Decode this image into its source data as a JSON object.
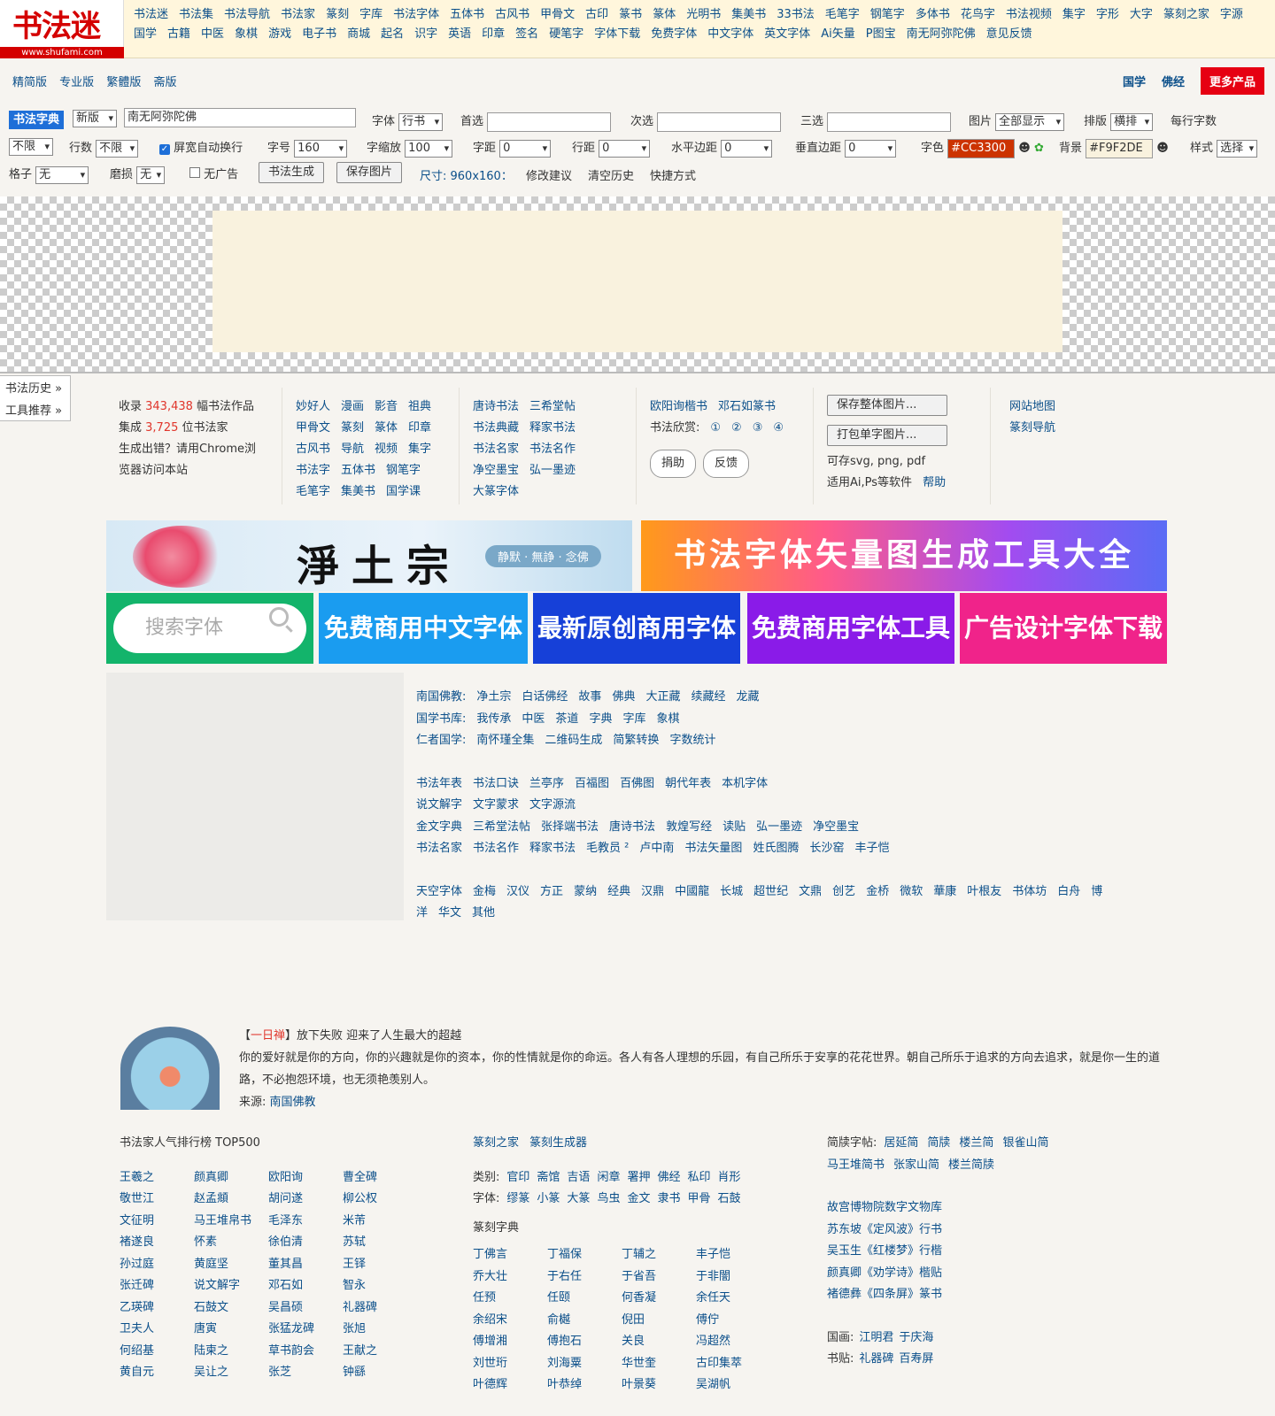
{
  "logo": {
    "text": "书法迷",
    "url": "www.shufami.com"
  },
  "topnav": [
    "书法迷",
    "书法集",
    "书法导航",
    "书法家",
    "篆刻",
    "字库",
    "书法字体",
    "五体书",
    "古风书",
    "甲骨文",
    "古印",
    "篆书",
    "篆体",
    "光明书",
    "集美书",
    "33书法",
    "毛笔字",
    "钢笔字",
    "多体书",
    "花鸟字",
    "书法视频",
    "集字",
    "字形",
    "大字",
    "篆刻之家",
    "字源",
    "国学",
    "古籍",
    "中医",
    "象棋",
    "游戏",
    "电子书",
    "商城",
    "起名",
    "识字",
    "英语",
    "印章",
    "签名",
    "硬笔字",
    "字体下载",
    "免费字体",
    "中文字体",
    "英文字体",
    "Ai矢量",
    "P图宝",
    "南无阿弥陀佛",
    "意见反馈"
  ],
  "versions": [
    "精简版",
    "专业版",
    "繁體版",
    "斋版"
  ],
  "right_buttons": {
    "guoxue": "国学",
    "fojing": "佛经",
    "more": "更多产品"
  },
  "controls": {
    "tag": "书法字典",
    "version_select": "新版",
    "text_value": "南无阿弥陀佛",
    "font_label": "字体",
    "font_value": "行书",
    "first_label": "首选",
    "second_label": "次选",
    "third_label": "三选",
    "image_label": "图片",
    "image_value": "全部显示",
    "layout_label": "排版",
    "layout_value": "横排",
    "perline_label": "每行字数",
    "perline_value": "不限",
    "rows_label": "行数",
    "rows_value": "不限",
    "autowrap": "屏宽自动换行",
    "size_label": "字号",
    "size_value": "160",
    "scale_label": "字缩放",
    "scale_value": "100",
    "spacing_label": "字距",
    "spacing_value": "0",
    "linespace_label": "行距",
    "linespace_value": "0",
    "hmargin_label": "水平边距",
    "hmargin_value": "0",
    "vmargin_label": "垂直边距",
    "vmargin_value": "0",
    "color_label": "字色",
    "color_value": "#CC3300",
    "bg_label": "背景",
    "bg_value": "#F9F2DE",
    "style_label": "样式",
    "style_value": "选择",
    "grid_label": "格子",
    "grid_value": "无",
    "wear_label": "磨损",
    "wear_value": "无",
    "noad": "无广告",
    "generate": "书法生成",
    "save": "保存图片",
    "size_info": "尺寸: 960x160：",
    "suggest": "修改建议",
    "clear": "清空历史",
    "shortcut": "快捷方式"
  },
  "colors": {
    "text_color": "#CC3300",
    "bg_color": "#F9F2DE",
    "accent": "#1e6fd8",
    "brand": "#d40000"
  },
  "sidetabs": [
    "书法历史 »",
    "工具推荐 »"
  ],
  "info": {
    "l1a": "收录 ",
    "l1n": "343,438",
    "l1b": " 幅书法作品",
    "l2a": "集成 ",
    "l2n": "3,725",
    "l2b": " 位书法家",
    "l3": "生成出错？请用Chrome浏",
    "l4": "览器访问本站"
  },
  "col2": [
    [
      "妙好人",
      "漫画",
      "影音",
      "祖典"
    ],
    [
      "甲骨文",
      "篆刻",
      "篆体",
      "印章"
    ],
    [
      "古风书",
      "导航",
      "视频",
      "集字"
    ],
    [
      "书法字",
      "五体书",
      "钢笔字"
    ],
    [
      "毛笔字",
      "集美书",
      "国学课"
    ]
  ],
  "col3": [
    [
      "唐诗书法",
      "三希堂帖"
    ],
    [
      "书法典藏",
      "释家书法"
    ],
    [
      "书法名家",
      "书法名作"
    ],
    [
      "净空墨宝",
      "弘一墨迹"
    ],
    [
      "大篆字体"
    ]
  ],
  "col4": {
    "r1": [
      "欧阳询楷书",
      "邓石如篆书"
    ],
    "appreciate": "书法欣赏:",
    "nums": [
      "①",
      "②",
      "③",
      "④"
    ],
    "donate": "捐助",
    "feedback": "反馈"
  },
  "col5": {
    "save_all": "保存整体图片...",
    "pack": "打包单字图片...",
    "note1": "可存svg, png, pdf",
    "note2": "适用Ai,Ps等软件",
    "help": "帮助"
  },
  "col6": [
    "网站地图",
    "篆刻导航"
  ],
  "banner1": {
    "title": "淨土宗",
    "pill": "静默 · 無諍 · 念佛"
  },
  "banner2": "书法字体矢量图生成工具大全",
  "search_placeholder": "搜索字体",
  "tiles": [
    "免费商用中文字体",
    "最新原创商用字体",
    "免费商用字体工具",
    "广告设计字体下载"
  ],
  "links2": {
    "r1": {
      "label": "南国佛教:",
      "items": [
        "净土宗",
        "白话佛经",
        "故事",
        "佛典",
        "大正藏",
        "续藏经",
        "龙藏"
      ]
    },
    "r2": {
      "label": "国学书库:",
      "items": [
        "我传承",
        "中医",
        "茶道",
        "字典",
        "字库",
        "象棋"
      ]
    },
    "r3": {
      "label": "仁者国学:",
      "items": [
        "南怀瑾全集",
        "二维码生成",
        "简繁转换",
        "字数统计"
      ]
    },
    "r4": [
      "书法年表",
      "书法口诀",
      "兰亭序",
      "百福图",
      "百佛图",
      "朝代年表",
      "本机字体"
    ],
    "r5": [
      "说文解字",
      "文字蒙求",
      "文字源流"
    ],
    "r6": [
      "金文字典",
      "三希堂法帖",
      "张择端书法",
      "唐诗书法",
      "敦煌写经",
      "读贴",
      "弘一墨迹",
      "净空墨宝"
    ],
    "r7": [
      "书法名家",
      "书法名作",
      "释家书法",
      "毛教员 ²",
      "卢中南",
      "书法矢量图",
      "姓氏图腾",
      "长沙窑",
      "丰子恺"
    ],
    "r8": [
      "天空字体",
      "金梅",
      "汉仪",
      "方正",
      "蒙纳",
      "经典",
      "汉鼎",
      "中國龍",
      "长城",
      "超世纪",
      "文鼎",
      "创艺",
      "金桥",
      "微软",
      "華康",
      "叶根友",
      "书体坊",
      "白舟",
      "博"
    ],
    "r9": [
      "洋",
      "华文",
      "其他"
    ]
  },
  "quote": {
    "bracket_l": "【",
    "tag": "一日禅",
    "bracket_r": "】",
    "title": "放下失败 迎来了人生最大的超越",
    "body": "你的爱好就是你的方向，你的兴趣就是你的资本，你的性情就是你的命运。各人有各人理想的乐园，有自己所乐于安享的花花世界。朝自己所乐于追求的方向去追求，就是你一生的道路，不必抱怨环境，也无须艳羡别人。",
    "source_label": "来源:",
    "source": "南国佛教"
  },
  "bottom_left": {
    "title": "书法家人气排行榜 TOP500",
    "names": [
      [
        "王羲之",
        "颜真卿",
        "欧阳询",
        "曹全碑"
      ],
      [
        "敬世江",
        "赵孟頫",
        "胡问遂",
        "柳公权"
      ],
      [
        "文征明",
        "马王堆帛书",
        "毛泽东",
        "米芾"
      ],
      [
        "褚遂良",
        "怀素",
        "徐伯清",
        "苏轼"
      ],
      [
        "孙过庭",
        "黄庭坚",
        "董其昌",
        "王铎"
      ],
      [
        "张迁碑",
        "说文解字",
        "邓石如",
        "智永"
      ],
      [
        "乙瑛碑",
        "石鼓文",
        "吴昌硕",
        "礼器碑"
      ],
      [
        "卫夫人",
        "唐寅",
        "张猛龙碑",
        "张旭"
      ],
      [
        "何绍基",
        "陆柬之",
        "草书韵会",
        "王献之"
      ],
      [
        "黄自元",
        "吴让之",
        "张芝",
        "钟繇"
      ]
    ]
  },
  "bottom_mid": {
    "t1": "篆刻之家",
    "t2": "篆刻生成器",
    "cat_label": "类别:",
    "cats": [
      "官印",
      "斋馆",
      "吉语",
      "闲章",
      "署押",
      "佛经",
      "私印",
      "肖形"
    ],
    "font_label": "字体:",
    "fonts": [
      "缪篆",
      "小篆",
      "大篆",
      "鸟虫",
      "金文",
      "隶书",
      "甲骨",
      "石鼓"
    ],
    "dict": "篆刻字典",
    "names": [
      [
        "丁佛言",
        "丁福保",
        "丁辅之",
        "丰子恺"
      ],
      [
        "乔大壮",
        "于右任",
        "于省吾",
        "于非闇"
      ],
      [
        "任预",
        "任颐",
        "何香凝",
        "余任天"
      ],
      [
        "余绍宋",
        "俞樾",
        "倪田",
        "傅佇"
      ],
      [
        "傅增湘",
        "傅抱石",
        "关良",
        "冯超然"
      ],
      [
        "刘世珩",
        "刘海粟",
        "华世奎",
        "古印集萃"
      ],
      [
        "叶德辉",
        "叶恭绰",
        "叶景葵",
        "吴湖帆"
      ]
    ]
  },
  "bottom_right": {
    "label": "简牍字帖:",
    "items": [
      "居延简",
      "简牍",
      "楼兰简",
      "银雀山简"
    ],
    "items2": [
      "马王堆简书",
      "张家山简",
      "楼兰简牍"
    ],
    "museum": "故宫博物院数字文物库",
    "works": [
      "苏东坡《定风波》行书",
      "吴玉生《红楼梦》行楷",
      "颜真卿《劝学诗》楷贴",
      "褚德彝《四条屏》篆书"
    ],
    "painting_label": "国画:",
    "paintings": [
      "江明君",
      "于庆海"
    ],
    "tie_label": "书贴:",
    "ties": [
      "礼器碑",
      "百寿屏"
    ]
  }
}
